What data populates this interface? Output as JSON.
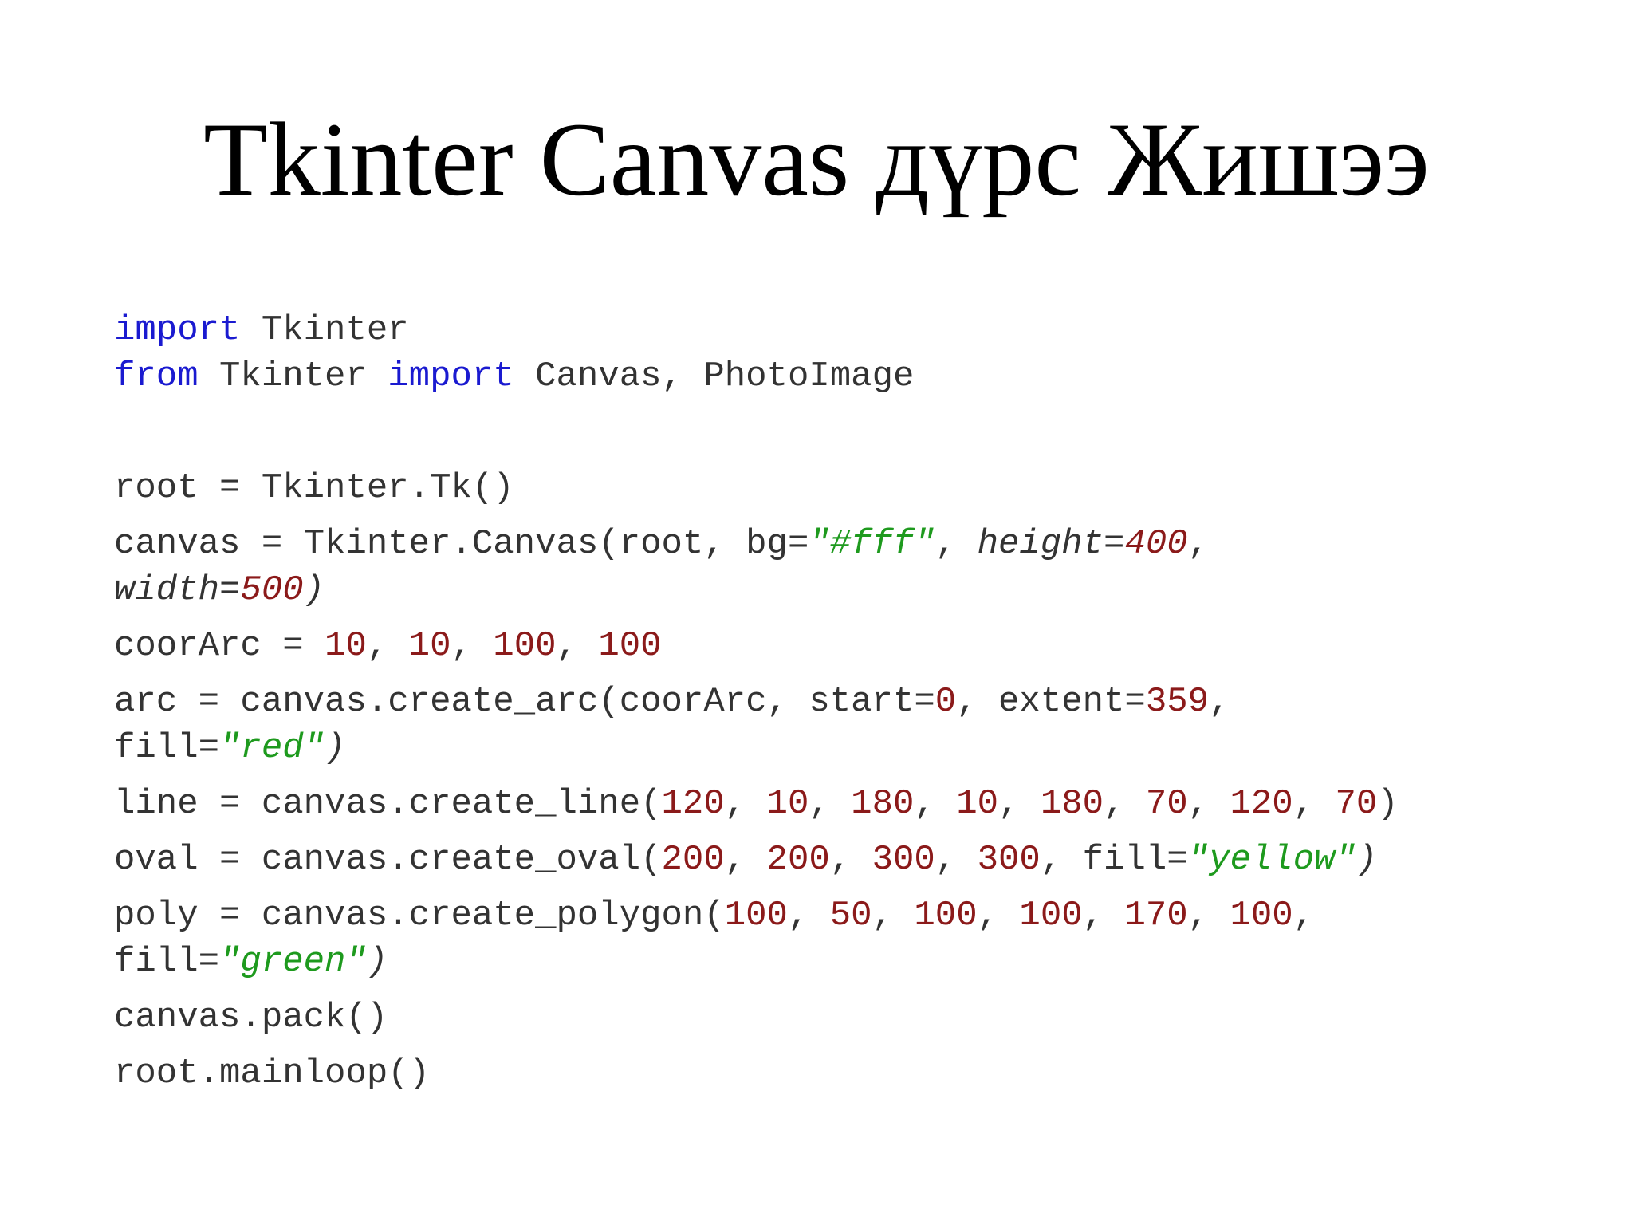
{
  "slide": {
    "title": "Tkinter Canvas дүрс Жишээ"
  },
  "code": {
    "l1": [
      {
        "t": "import",
        "c": "kw"
      },
      {
        "t": " Tkinter",
        "c": ""
      }
    ],
    "l2": [
      {
        "t": "from",
        "c": "kw"
      },
      {
        "t": " Tkinter ",
        "c": ""
      },
      {
        "t": "import",
        "c": "kw"
      },
      {
        "t": " Canvas, PhotoImage",
        "c": ""
      }
    ],
    "l3": [
      {
        "t": "root = Tkinter.Tk()",
        "c": ""
      }
    ],
    "l4": [
      {
        "t": "canvas = Tkinter.Canvas(root, bg=",
        "c": ""
      },
      {
        "t": "\"#fff\"",
        "c": "str"
      },
      {
        "t": ", ",
        "c": ""
      },
      {
        "t": "height=",
        "c": "it"
      },
      {
        "t": "400",
        "c": "num it"
      },
      {
        "t": ",",
        "c": ""
      }
    ],
    "l5": [
      {
        "t": "width=",
        "c": "it"
      },
      {
        "t": "500",
        "c": "num it"
      },
      {
        "t": ")",
        "c": "it"
      }
    ],
    "l6": [
      {
        "t": "coorArc = ",
        "c": ""
      },
      {
        "t": "10",
        "c": "num"
      },
      {
        "t": ", ",
        "c": ""
      },
      {
        "t": "10",
        "c": "num"
      },
      {
        "t": ", ",
        "c": ""
      },
      {
        "t": "100",
        "c": "num"
      },
      {
        "t": ", ",
        "c": ""
      },
      {
        "t": "100",
        "c": "num"
      }
    ],
    "l7": [
      {
        "t": "arc = canvas.create_arc(coorArc, start=",
        "c": ""
      },
      {
        "t": "0",
        "c": "num"
      },
      {
        "t": ", extent=",
        "c": ""
      },
      {
        "t": "359",
        "c": "num"
      },
      {
        "t": ",",
        "c": ""
      }
    ],
    "l8": [
      {
        "t": "fill=",
        "c": ""
      },
      {
        "t": "\"red\"",
        "c": "str"
      },
      {
        "t": ")",
        "c": "it"
      }
    ],
    "l9": [
      {
        "t": "line = canvas.create_line(",
        "c": ""
      },
      {
        "t": "120",
        "c": "num"
      },
      {
        "t": ", ",
        "c": ""
      },
      {
        "t": "10",
        "c": "num"
      },
      {
        "t": ", ",
        "c": ""
      },
      {
        "t": "180",
        "c": "num"
      },
      {
        "t": ", ",
        "c": ""
      },
      {
        "t": "10",
        "c": "num"
      },
      {
        "t": ", ",
        "c": ""
      },
      {
        "t": "180",
        "c": "num"
      },
      {
        "t": ", ",
        "c": ""
      },
      {
        "t": "70",
        "c": "num"
      },
      {
        "t": ", ",
        "c": ""
      },
      {
        "t": "120",
        "c": "num"
      },
      {
        "t": ", ",
        "c": ""
      },
      {
        "t": "70",
        "c": "num"
      },
      {
        "t": ")",
        "c": ""
      }
    ],
    "l10": [
      {
        "t": "oval = canvas.create_oval(",
        "c": ""
      },
      {
        "t": "200",
        "c": "num"
      },
      {
        "t": ", ",
        "c": ""
      },
      {
        "t": "200",
        "c": "num"
      },
      {
        "t": ", ",
        "c": ""
      },
      {
        "t": "300",
        "c": "num"
      },
      {
        "t": ", ",
        "c": ""
      },
      {
        "t": "300",
        "c": "num"
      },
      {
        "t": ", fill=",
        "c": ""
      },
      {
        "t": "\"yellow\"",
        "c": "str"
      },
      {
        "t": ")",
        "c": "it"
      }
    ],
    "l11": [
      {
        "t": "poly = canvas.create_polygon(",
        "c": ""
      },
      {
        "t": "100",
        "c": "num"
      },
      {
        "t": ", ",
        "c": ""
      },
      {
        "t": "50",
        "c": "num"
      },
      {
        "t": ", ",
        "c": ""
      },
      {
        "t": "100",
        "c": "num"
      },
      {
        "t": ", ",
        "c": ""
      },
      {
        "t": "100",
        "c": "num"
      },
      {
        "t": ", ",
        "c": ""
      },
      {
        "t": "170",
        "c": "num"
      },
      {
        "t": ", ",
        "c": ""
      },
      {
        "t": "100",
        "c": "num"
      },
      {
        "t": ",",
        "c": ""
      }
    ],
    "l12": [
      {
        "t": "fill=",
        "c": ""
      },
      {
        "t": "\"green\"",
        "c": "str"
      },
      {
        "t": ")",
        "c": "it"
      }
    ],
    "l13": [
      {
        "t": "canvas.pack()",
        "c": ""
      }
    ],
    "l14": [
      {
        "t": "root.mainloop()",
        "c": ""
      }
    ]
  },
  "colors": {
    "keyword": "#1a1ad0",
    "number": "#8b1a1a",
    "string": "#1e9a1e",
    "text": "#333333",
    "title": "#000000",
    "background": "#ffffff"
  }
}
